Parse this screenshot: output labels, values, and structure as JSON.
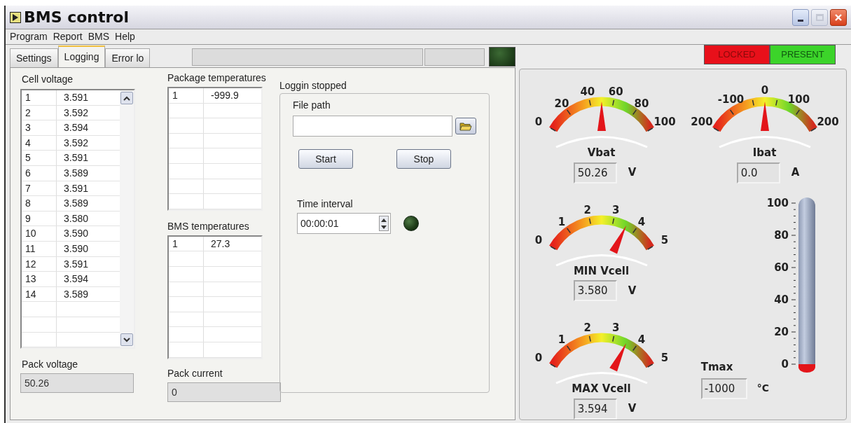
{
  "window": {
    "title": "BMS control"
  },
  "menu": [
    "Program",
    "Report",
    "BMS",
    "Help"
  ],
  "tabs": [
    {
      "label": "Settings",
      "selected": false
    },
    {
      "label": "Logging",
      "selected": true
    },
    {
      "label": "Error lo",
      "selected": false
    }
  ],
  "status_led": {
    "on": false
  },
  "indicators": [
    {
      "label": "LOCKED",
      "color": "#e8101a"
    },
    {
      "label": "PRESENT",
      "color": "#3cd42a"
    }
  ],
  "cell_voltage": {
    "label": "Cell voltage",
    "rows": [
      [
        "1",
        "3.591"
      ],
      [
        "2",
        "3.592"
      ],
      [
        "3",
        "3.594"
      ],
      [
        "4",
        "3.592"
      ],
      [
        "5",
        "3.591"
      ],
      [
        "6",
        "3.589"
      ],
      [
        "7",
        "3.591"
      ],
      [
        "8",
        "3.589"
      ],
      [
        "9",
        "3.580"
      ],
      [
        "10",
        "3.590"
      ],
      [
        "11",
        "3.590"
      ],
      [
        "12",
        "3.591"
      ],
      [
        "13",
        "3.594"
      ],
      [
        "14",
        "3.589"
      ]
    ]
  },
  "package_temperatures": {
    "label": "Package temperatures",
    "rows": [
      [
        "1",
        "-999.9"
      ]
    ]
  },
  "bms_temperatures": {
    "label": "BMS temperatures",
    "rows": [
      [
        "1",
        "27.3"
      ]
    ]
  },
  "pack_voltage": {
    "label": "Pack voltage",
    "value": "50.26"
  },
  "pack_current": {
    "label": "Pack current",
    "value": "0"
  },
  "logging": {
    "status": "Loggin stopped",
    "file_path_label": "File path",
    "buttons": [
      "Start",
      "Stop"
    ],
    "time_interval_label": "Time interval",
    "time_interval": "00:00:01",
    "led_on": false
  },
  "gauges": [
    {
      "label": "Vbat",
      "ticks": [
        "0",
        "20",
        "40",
        "60",
        "80",
        "100"
      ],
      "value": "50.26",
      "unit": "V"
    },
    {
      "label": "Ibat",
      "ticks": [
        "200",
        "-100",
        "0",
        "100",
        "200"
      ],
      "value": "0.0",
      "unit": "A"
    },
    {
      "label": "MIN Vcell",
      "ticks": [
        "0",
        "1",
        "2",
        "3",
        "4",
        "5"
      ],
      "value": "3.580",
      "unit": "V"
    },
    {
      "label": "MAX Vcell",
      "ticks": [
        "0",
        "1",
        "2",
        "3",
        "4",
        "5"
      ],
      "value": "3.594",
      "unit": "V"
    }
  ],
  "thermometer": {
    "label": "Tmax",
    "ticks": [
      "100",
      "80",
      "60",
      "40",
      "20",
      "0"
    ],
    "value": "-1000",
    "unit": "°C"
  }
}
